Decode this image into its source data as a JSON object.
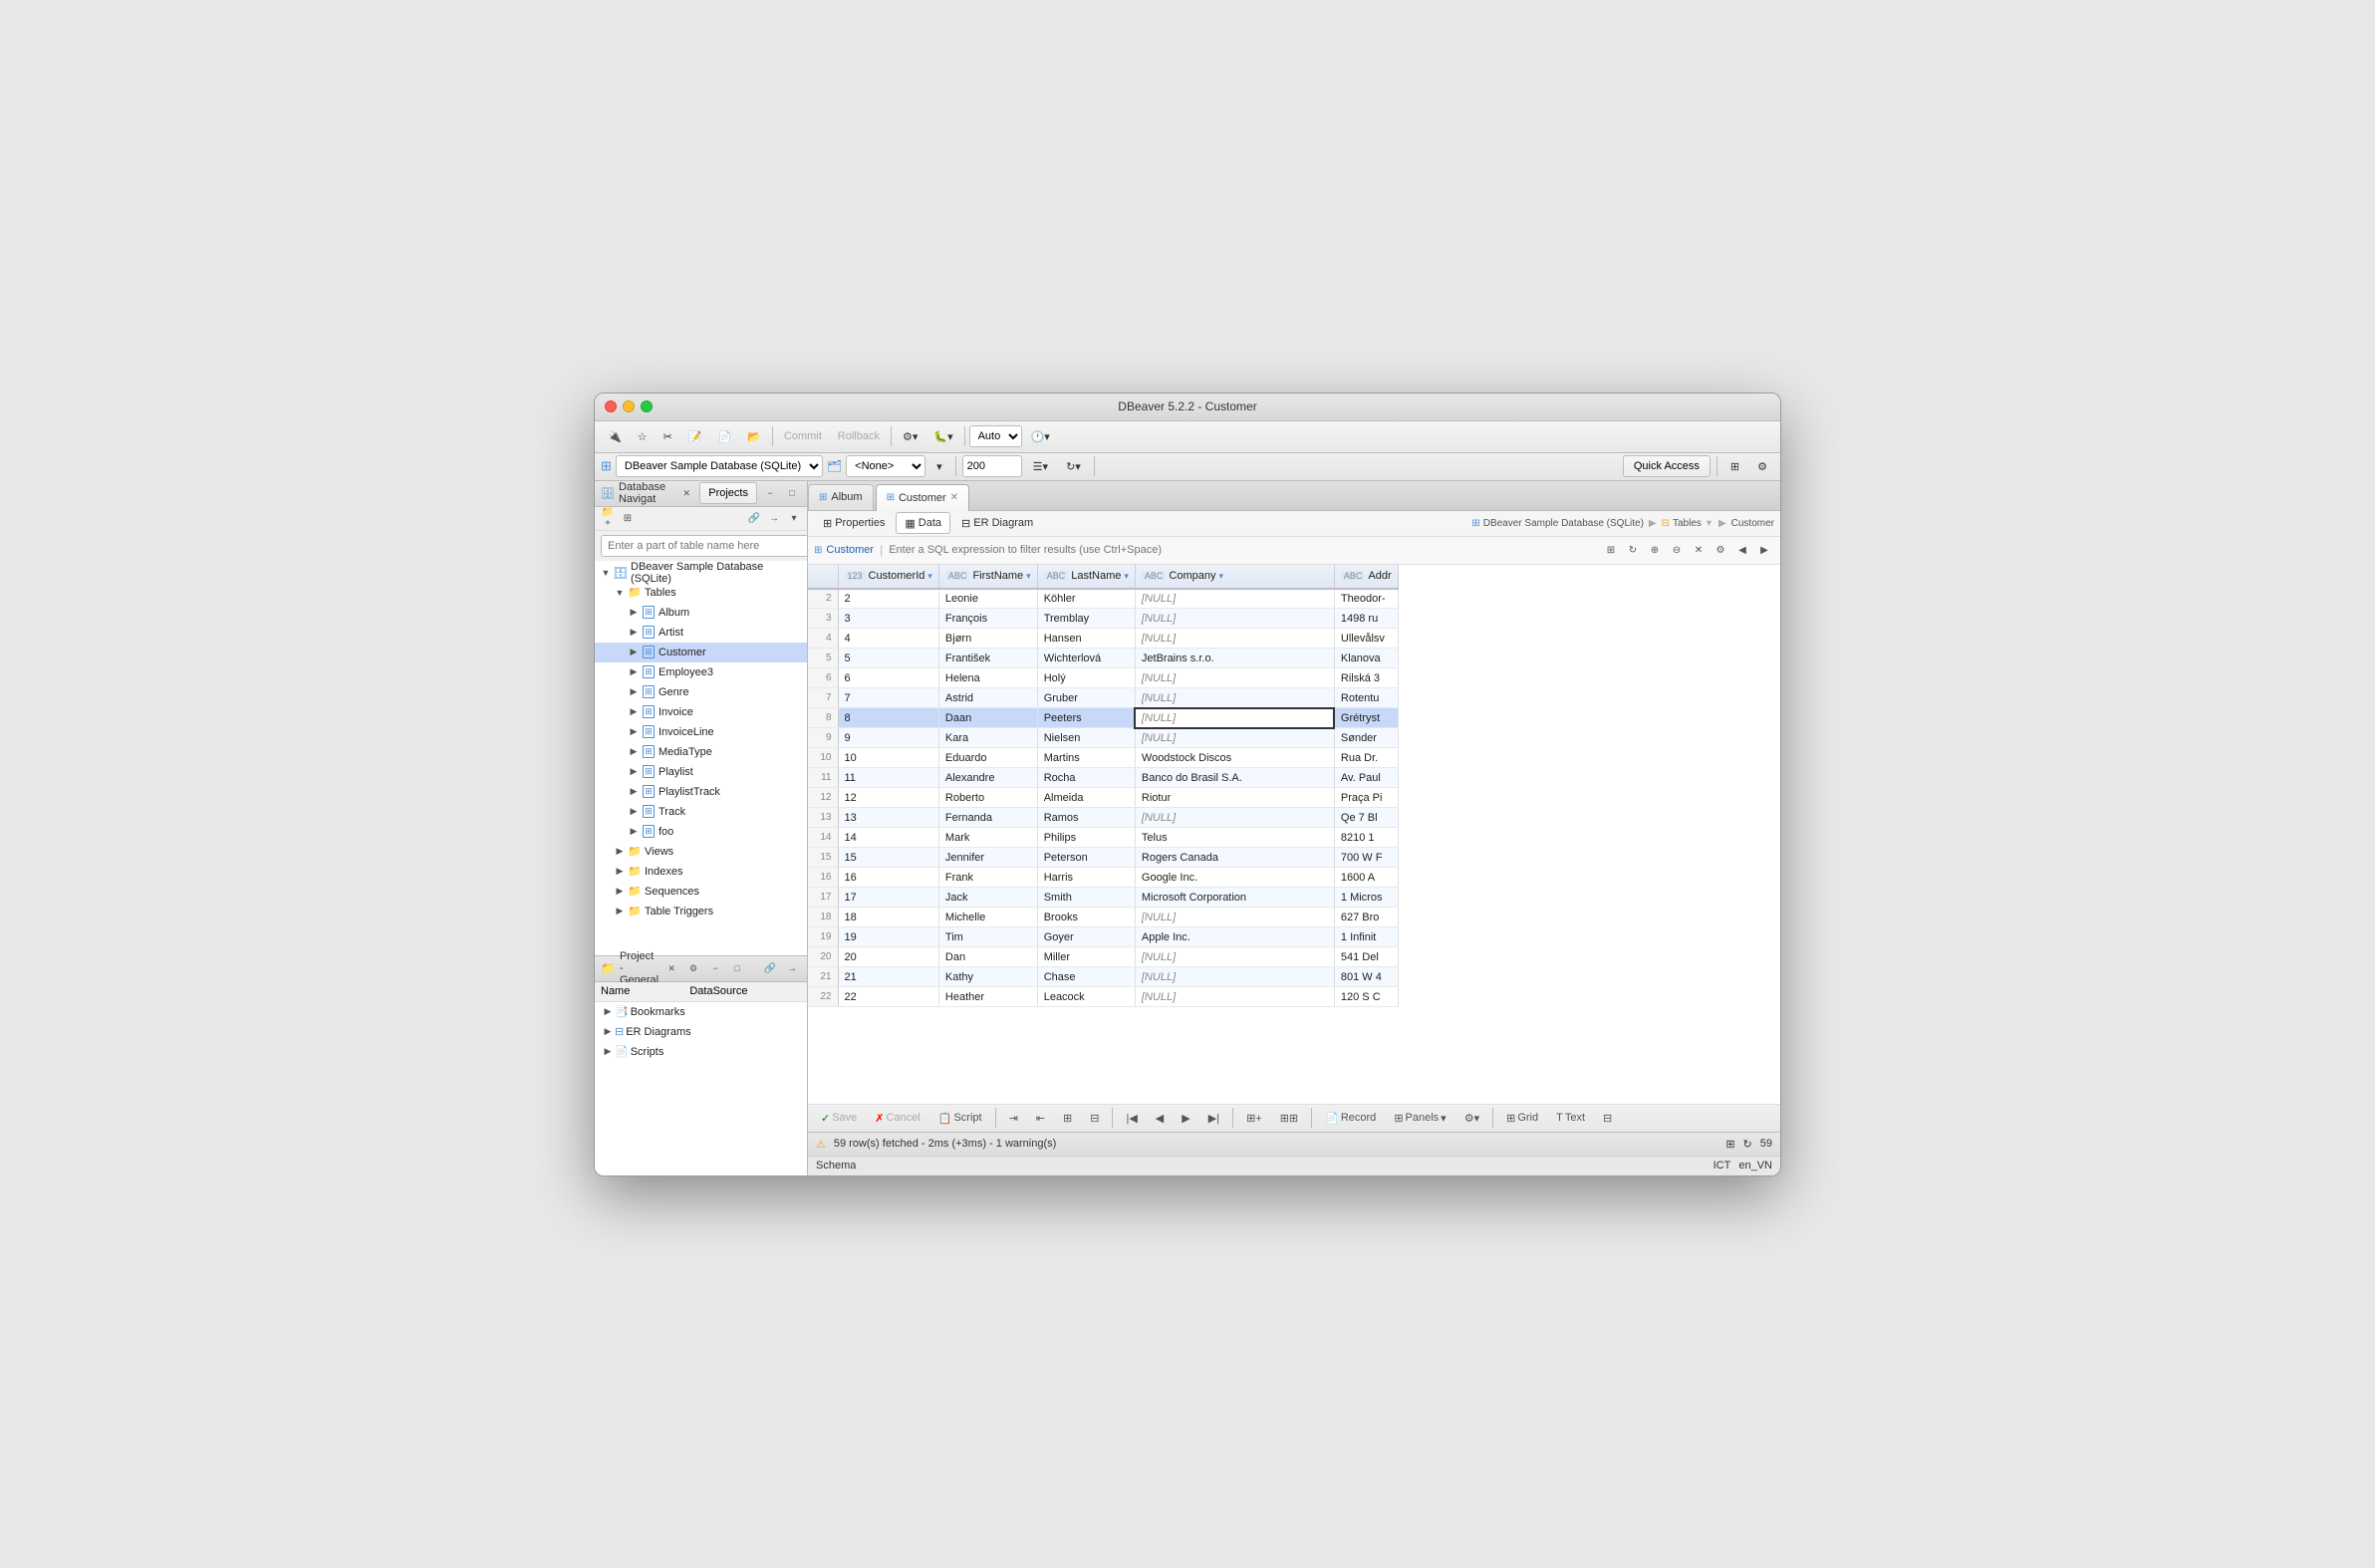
{
  "window": {
    "title": "DBeaver 5.2.2 - Customer",
    "traffic_lights": [
      "close",
      "minimize",
      "maximize"
    ]
  },
  "toolbar": {
    "buttons": [
      "db-icon",
      "hand-icon",
      "scissors-icon",
      "select-icon",
      "select-add-icon",
      "select-remove-icon"
    ],
    "commit_label": "Commit",
    "rollback_label": "Rollback",
    "settings_icon": "⚙",
    "auto_label": "Auto",
    "clock_icon": "🕐"
  },
  "dbbar": {
    "db_label": "DBeaver Sample Database (SQLite)",
    "schema_label": "<None>",
    "row_limit": "200",
    "quick_access": "Quick Access"
  },
  "nav_panel": {
    "title": "Database Navigat",
    "tabs": [
      "Projects"
    ],
    "search_placeholder": "Enter a part of table name here",
    "tree": [
      {
        "indent": 1,
        "label": "DBeaver Sample Database (SQLite)",
        "type": "db",
        "expanded": true
      },
      {
        "indent": 2,
        "label": "Tables",
        "type": "folder",
        "expanded": true
      },
      {
        "indent": 3,
        "label": "Album",
        "type": "table"
      },
      {
        "indent": 3,
        "label": "Artist",
        "type": "table"
      },
      {
        "indent": 3,
        "label": "Customer",
        "type": "table",
        "selected": true
      },
      {
        "indent": 3,
        "label": "Employee3",
        "type": "table"
      },
      {
        "indent": 3,
        "label": "Genre",
        "type": "table"
      },
      {
        "indent": 3,
        "label": "Invoice",
        "type": "table"
      },
      {
        "indent": 3,
        "label": "InvoiceLine",
        "type": "table"
      },
      {
        "indent": 3,
        "label": "MediaType",
        "type": "table"
      },
      {
        "indent": 3,
        "label": "Playlist",
        "type": "table"
      },
      {
        "indent": 3,
        "label": "PlaylistTrack",
        "type": "table"
      },
      {
        "indent": 3,
        "label": "Track",
        "type": "table"
      },
      {
        "indent": 3,
        "label": "foo",
        "type": "table"
      },
      {
        "indent": 2,
        "label": "Views",
        "type": "folder"
      },
      {
        "indent": 2,
        "label": "Indexes",
        "type": "folder"
      },
      {
        "indent": 2,
        "label": "Sequences",
        "type": "folder"
      },
      {
        "indent": 2,
        "label": "Table Triggers",
        "type": "folder"
      }
    ]
  },
  "project_panel": {
    "title": "Project - General",
    "columns": [
      "Name",
      "DataSource"
    ],
    "items": [
      {
        "indent": 1,
        "label": "Bookmarks",
        "type": "bookmark"
      },
      {
        "indent": 1,
        "label": "ER Diagrams",
        "type": "er"
      },
      {
        "indent": 1,
        "label": "Scripts",
        "type": "script"
      }
    ]
  },
  "tabs": [
    {
      "label": "Album",
      "icon": "table",
      "active": false,
      "closeable": false
    },
    {
      "label": "Customer",
      "icon": "table",
      "active": true,
      "closeable": true
    }
  ],
  "subtabs": [
    {
      "label": "Properties",
      "icon": "⊞",
      "active": false
    },
    {
      "label": "Data",
      "icon": "▦",
      "active": true
    },
    {
      "label": "ER Diagram",
      "icon": "⊟",
      "active": false
    }
  ],
  "breadcrumb": {
    "db": "DBeaver Sample Database (SQLite)",
    "section": "Tables",
    "table": "Customer"
  },
  "filter": {
    "table_label": "Customer",
    "placeholder": "Enter a SQL expression to filter results (use Ctrl+Space)"
  },
  "columns": [
    {
      "name": "CustomerId",
      "type": "123"
    },
    {
      "name": "FirstName",
      "type": "ABC"
    },
    {
      "name": "LastName",
      "type": "ABC"
    },
    {
      "name": "Company",
      "type": "ABC"
    },
    {
      "name": "Addr",
      "type": "ABC"
    }
  ],
  "rows": [
    {
      "num": "2",
      "id": "2",
      "first": "Leonie",
      "last": "Köhler",
      "company": "[NULL]",
      "addr": "Theodor-"
    },
    {
      "num": "3",
      "id": "3",
      "first": "François",
      "last": "Tremblay",
      "company": "[NULL]",
      "addr": "1498 ru"
    },
    {
      "num": "4",
      "id": "4",
      "first": "Bjørn",
      "last": "Hansen",
      "company": "[NULL]",
      "addr": "Ullevålsv"
    },
    {
      "num": "5",
      "id": "5",
      "first": "František",
      "last": "Wichterlová",
      "company": "JetBrains s.r.o.",
      "addr": "Klanova"
    },
    {
      "num": "6",
      "id": "6",
      "first": "Helena",
      "last": "Holý",
      "company": "[NULL]",
      "addr": "Rilská 3"
    },
    {
      "num": "7",
      "id": "7",
      "first": "Astrid",
      "last": "Gruber",
      "company": "[NULL]",
      "addr": "Rotentu"
    },
    {
      "num": "8",
      "id": "8",
      "first": "Daan",
      "last": "Peeters",
      "company": "[NULL]",
      "addr": "Grétryst",
      "selected": true
    },
    {
      "num": "9",
      "id": "9",
      "first": "Kara",
      "last": "Nielsen",
      "company": "[NULL]",
      "addr": "Sønder"
    },
    {
      "num": "10",
      "id": "10",
      "first": "Eduardo",
      "last": "Martins",
      "company": "Woodstock Discos",
      "addr": "Rua Dr."
    },
    {
      "num": "11",
      "id": "11",
      "first": "Alexandre",
      "last": "Rocha",
      "company": "Banco do Brasil S.A.",
      "addr": "Av. Paul"
    },
    {
      "num": "12",
      "id": "12",
      "first": "Roberto",
      "last": "Almeida",
      "company": "Riotur",
      "addr": "Praça Pi"
    },
    {
      "num": "13",
      "id": "13",
      "first": "Fernanda",
      "last": "Ramos",
      "company": "[NULL]",
      "addr": "Qe 7 Bl"
    },
    {
      "num": "14",
      "id": "14",
      "first": "Mark",
      "last": "Philips",
      "company": "Telus",
      "addr": "8210 1"
    },
    {
      "num": "15",
      "id": "15",
      "first": "Jennifer",
      "last": "Peterson",
      "company": "Rogers Canada",
      "addr": "700 W F"
    },
    {
      "num": "16",
      "id": "16",
      "first": "Frank",
      "last": "Harris",
      "company": "Google Inc.",
      "addr": "1600 A"
    },
    {
      "num": "17",
      "id": "17",
      "first": "Jack",
      "last": "Smith",
      "company": "Microsoft Corporation",
      "addr": "1 Micros"
    },
    {
      "num": "18",
      "id": "18",
      "first": "Michelle",
      "last": "Brooks",
      "company": "[NULL]",
      "addr": "627 Bro"
    },
    {
      "num": "19",
      "id": "19",
      "first": "Tim",
      "last": "Goyer",
      "company": "Apple Inc.",
      "addr": "1 Infinit"
    },
    {
      "num": "20",
      "id": "20",
      "first": "Dan",
      "last": "Miller",
      "company": "[NULL]",
      "addr": "541 Del"
    },
    {
      "num": "21",
      "id": "21",
      "first": "Kathy",
      "last": "Chase",
      "company": "[NULL]",
      "addr": "801 W 4"
    },
    {
      "num": "22",
      "id": "22",
      "first": "Heather",
      "last": "Leacock",
      "company": "[NULL]",
      "addr": "120 S C"
    }
  ],
  "bottom_toolbar": {
    "save_label": "Save",
    "cancel_label": "Cancel",
    "script_label": "Script",
    "record_label": "Record",
    "panels_label": "Panels",
    "grid_label": "Grid",
    "text_label": "Text",
    "nav_buttons": [
      "first",
      "prev",
      "prev-page",
      "next-page",
      "next",
      "last"
    ]
  },
  "status_bar": {
    "message": "59 row(s) fetched - 2ms (+3ms) - 1 warning(s)",
    "locale": "ICT",
    "lang": "en_VN",
    "row_count": "59",
    "schema": "Schema"
  }
}
